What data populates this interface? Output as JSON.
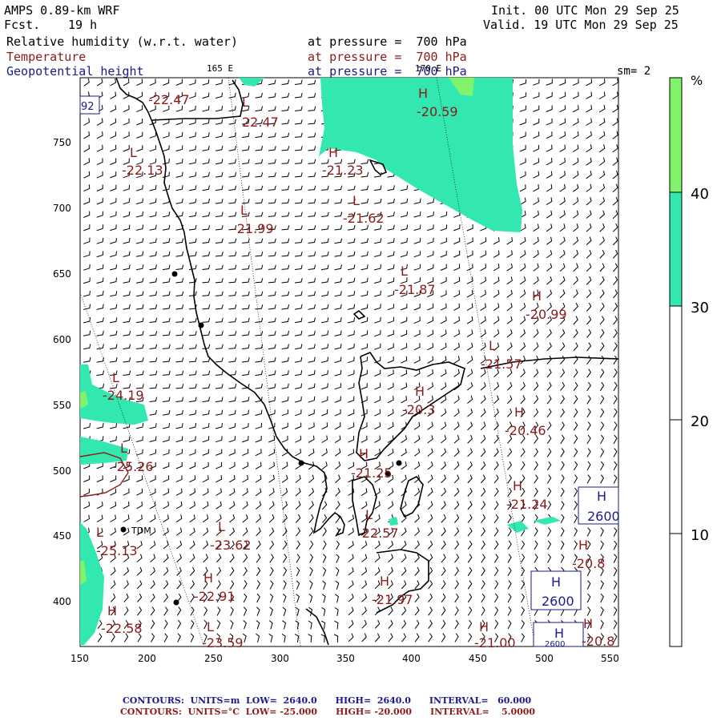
{
  "header": {
    "model": "AMPS 0.89-km WRF",
    "fcst_label": "Fcst.",
    "fcst_value": "19 h",
    "init": "Init. 00 UTC Mon 29 Sep 25",
    "valid": "Valid. 19 UTC Mon 29 Sep 25",
    "field1": "Relative humidity (w.r.t. water)",
    "field2": "Temperature",
    "field3": "Geopotential height",
    "pressure1": "at pressure =  700 hPa",
    "pressure2": "at pressure =  700 hPa",
    "pressure3": "at pressure =  700 hPa",
    "lon165": "165 E",
    "lon170": "170 E",
    "sm": "sm= 2"
  },
  "axes": {
    "x_ticks": [
      "150",
      "200",
      "250",
      "300",
      "350",
      "400",
      "450",
      "500",
      "550"
    ],
    "y_ticks": [
      "750",
      "700",
      "650",
      "600",
      "550",
      "500",
      "450",
      "400"
    ]
  },
  "colorbar": {
    "unit": "%",
    "labels": [
      "40",
      "30",
      "20",
      "10"
    ],
    "colors": {
      "top": "#7ff36a",
      "mid": "#33e8b0",
      "low": "#ffffff"
    }
  },
  "colors": {
    "humidity_green": "#33e8b0",
    "humidity_lightgreen": "#7ff36a",
    "temp_red": "#8b1a1a",
    "height_blue": "#1a1a8b",
    "coast": "#000000"
  },
  "labels": {
    "temp": [
      {
        "t": "-22.47"
      },
      {
        "t": "L"
      },
      {
        "t": "22.47"
      },
      {
        "t": "H"
      },
      {
        "t": "-20.59"
      },
      {
        "t": "L"
      },
      {
        "t": "-22.13"
      },
      {
        "t": "H"
      },
      {
        "t": "-21.23"
      },
      {
        "t": "L"
      },
      {
        "t": "-21.62"
      },
      {
        "t": "L"
      },
      {
        "t": "-21.99"
      },
      {
        "t": "L"
      },
      {
        "t": "-21.87"
      },
      {
        "t": "H"
      },
      {
        "t": "-20.99"
      },
      {
        "t": "L"
      },
      {
        "t": "-21.57"
      },
      {
        "t": "L"
      },
      {
        "t": "-24.19"
      },
      {
        "t": "H"
      },
      {
        "t": "-20.3"
      },
      {
        "t": "H"
      },
      {
        "t": "-20.46"
      },
      {
        "t": "L"
      },
      {
        "t": "-25.26"
      },
      {
        "t": "H"
      },
      {
        "t": "-21.25"
      },
      {
        "t": "H"
      },
      {
        "t": "-21.24"
      },
      {
        "t": "L"
      },
      {
        "t": "-22.57"
      },
      {
        "t": "L"
      },
      {
        "t": "-25.13"
      },
      {
        "t": "L"
      },
      {
        "t": "-23.62"
      },
      {
        "t": "H"
      },
      {
        "t": "-20.8"
      },
      {
        "t": "H"
      },
      {
        "t": "-22.91"
      },
      {
        "t": "H"
      },
      {
        "t": "-21.97"
      },
      {
        "t": "H"
      },
      {
        "t": "-22.58"
      },
      {
        "t": "L"
      },
      {
        "t": "-23.59"
      },
      {
        "t": "H"
      },
      {
        "t": "-21.00"
      },
      {
        "t": "H"
      },
      {
        "t": "-20.8"
      }
    ],
    "place": "TDM",
    "heights": [
      {
        "t": "H"
      },
      {
        "t": "2600"
      },
      {
        "t": "H"
      },
      {
        "t": "2600"
      },
      {
        "t": "H"
      },
      {
        "t": "2600"
      }
    ],
    "corner": "92"
  },
  "footer": {
    "line1": "CONTOURS:  UNITS=m  LOW=  2640.0      HIGH=  2640.0      INTERVAL=   60.000",
    "line2": "CONTOURS:  UNITS=°C  LOW= -25.000      HIGH= -20.000      INTERVAL=    5.0000"
  }
}
